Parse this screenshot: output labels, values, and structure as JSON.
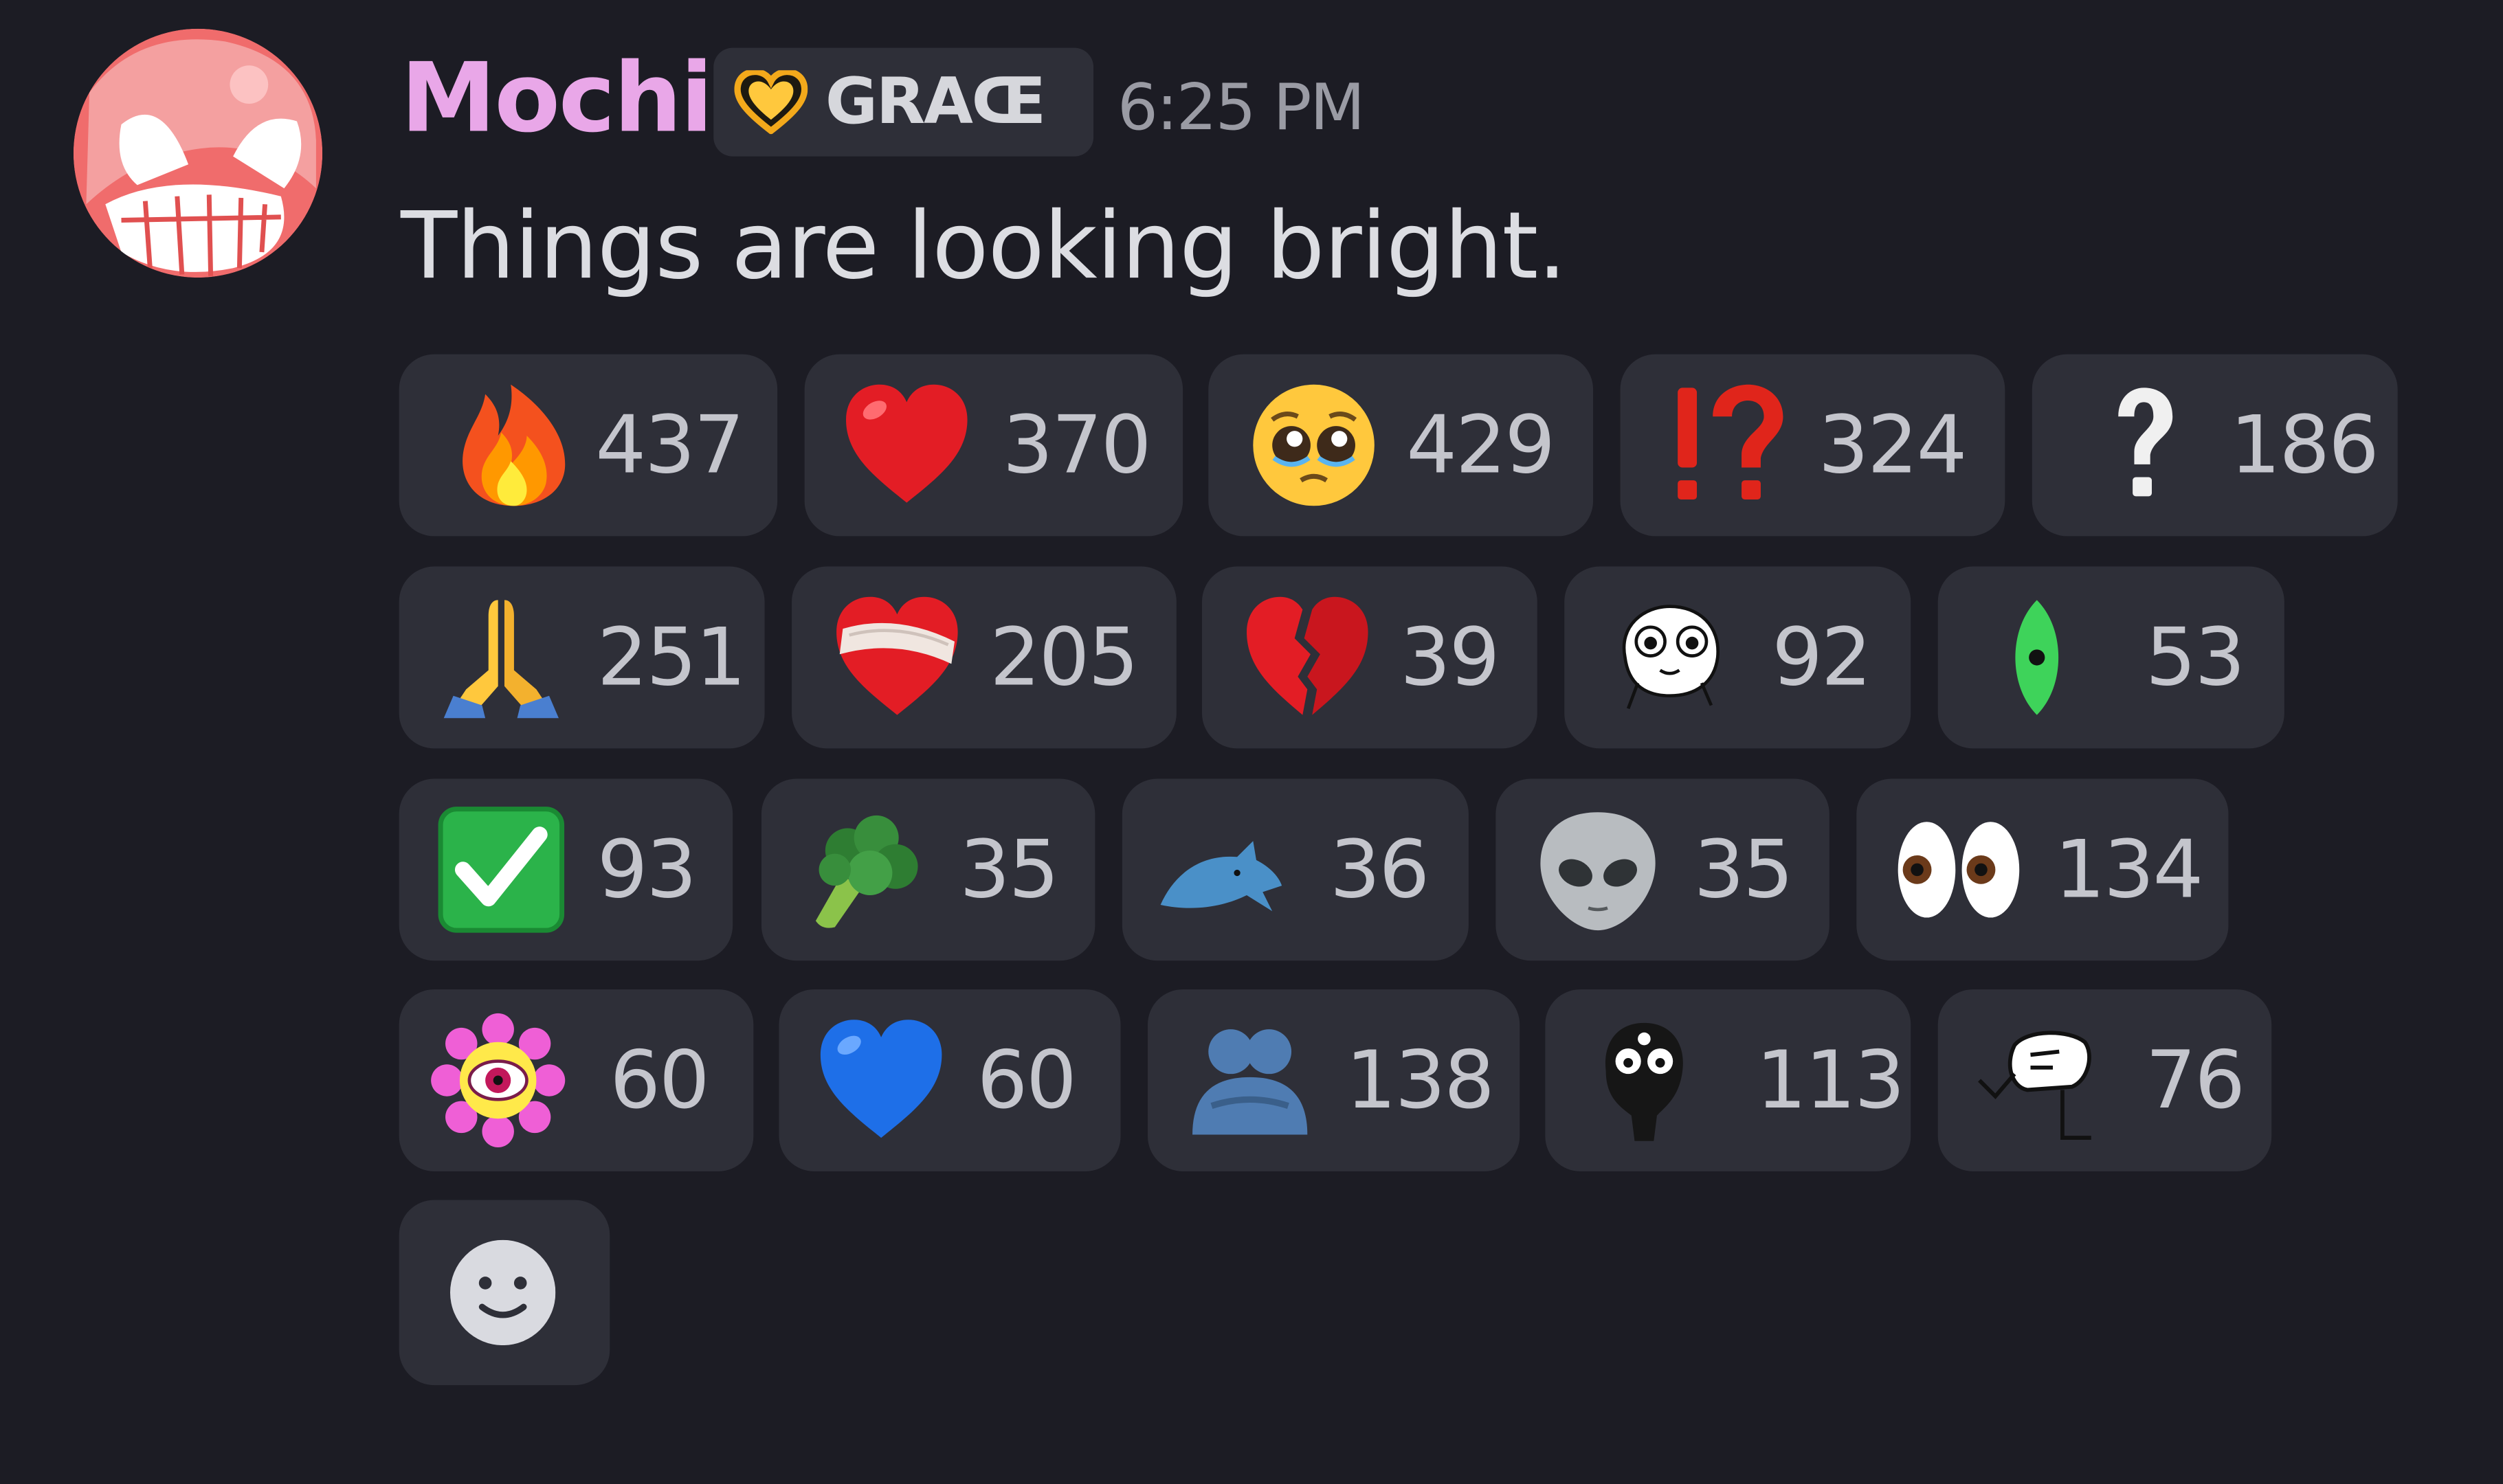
{
  "message": {
    "username": "Mochi",
    "tag": "GRACE",
    "tag_display": "GRAŒ",
    "timestamp": "6:25 PM",
    "text": "Things are looking bright."
  },
  "colors": {
    "background": "#1c1c24",
    "username": "#e9a7e8",
    "reaction_bg": "#2e2f38",
    "text": "#dcdde2",
    "count": "#c4c5cc",
    "timestamp": "#9a9ba4"
  },
  "reactions": [
    {
      "emoji": "fire-icon",
      "count": "437"
    },
    {
      "emoji": "red-heart-icon",
      "count": "370"
    },
    {
      "emoji": "pleading-face-icon",
      "count": "429"
    },
    {
      "emoji": "interrobang-icon",
      "count": "324"
    },
    {
      "emoji": "question-mark-icon",
      "count": "186"
    },
    {
      "emoji": "praying-hands-icon",
      "count": "251"
    },
    {
      "emoji": "mending-heart-icon",
      "count": "205"
    },
    {
      "emoji": "broken-heart-icon",
      "count": "39"
    },
    {
      "emoji": "custom-doodle-face-icon",
      "count": "92"
    },
    {
      "emoji": "custom-green-eye-icon",
      "count": "53"
    },
    {
      "emoji": "check-mark-button-icon",
      "count": "93"
    },
    {
      "emoji": "broccoli-icon",
      "count": "35"
    },
    {
      "emoji": "custom-blue-fish-icon",
      "count": "36"
    },
    {
      "emoji": "alien-icon",
      "count": "35"
    },
    {
      "emoji": "eyes-icon",
      "count": "134"
    },
    {
      "emoji": "custom-flower-eye-icon",
      "count": "60"
    },
    {
      "emoji": "blue-heart-icon",
      "count": "60"
    },
    {
      "emoji": "people-hugging-icon",
      "count": "138"
    },
    {
      "emoji": "custom-fuzzy-creature-icon",
      "count": "113"
    },
    {
      "emoji": "custom-sketch-creature-icon",
      "count": "76"
    }
  ],
  "add_reaction": {
    "icon": "smiley-add-reaction-icon"
  }
}
